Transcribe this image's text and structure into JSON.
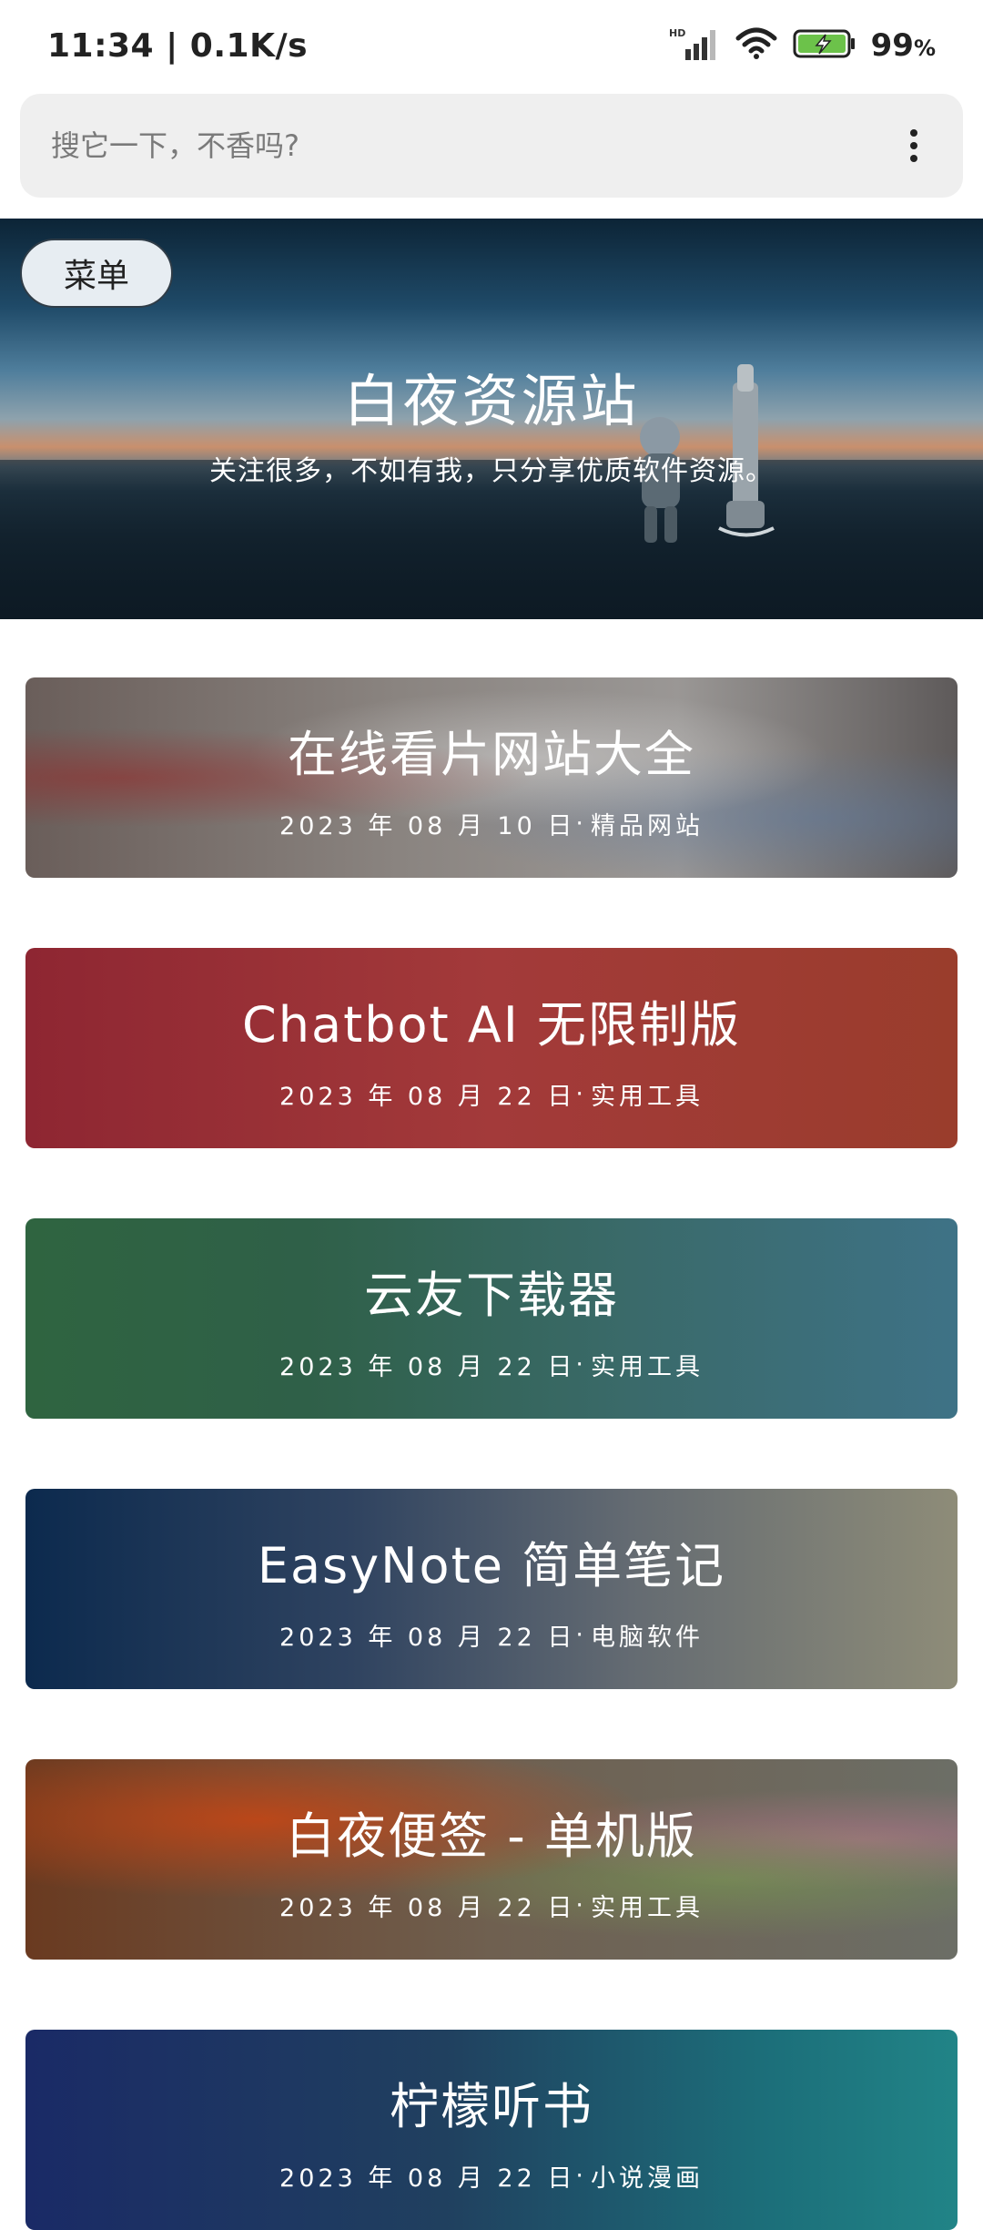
{
  "status_bar": {
    "time": "11:34 | 0.1K/s",
    "network_label": "HD",
    "battery": "99",
    "battery_unit": "%"
  },
  "search": {
    "placeholder": "搜它一下，不香吗?"
  },
  "hero": {
    "menu_label": "菜单",
    "title": "白夜资源站",
    "subtitle": "关注很多，不如有我，只分享优质软件资源。"
  },
  "cards": [
    {
      "title": "在线看片网站大全",
      "date": "2023 年 08 月 10 日",
      "sep": "·",
      "category": "精品网站"
    },
    {
      "title": "Chatbot AI 无限制版",
      "date": "2023 年 08 月 22 日",
      "sep": "·",
      "category": "实用工具"
    },
    {
      "title": "云友下载器",
      "date": "2023 年 08 月 22 日",
      "sep": "·",
      "category": "实用工具"
    },
    {
      "title": "EasyNote 简单笔记",
      "date": "2023 年 08 月 22 日",
      "sep": "·",
      "category": "电脑软件"
    },
    {
      "title": "白夜便签 - 单机版",
      "date": "2023 年 08 月 22 日",
      "sep": "·",
      "category": "实用工具"
    },
    {
      "title": "柠檬听书",
      "date": "2023 年 08 月 22 日",
      "sep": "·",
      "category": "小说漫画"
    }
  ],
  "colors": {
    "search_bg": "#efefef",
    "menu_button_bg": "#e7edf2",
    "text_dark": "#222222"
  },
  "icons": [
    "signal-icon",
    "wifi-icon",
    "battery-charging-icon",
    "more-vertical-icon"
  ]
}
